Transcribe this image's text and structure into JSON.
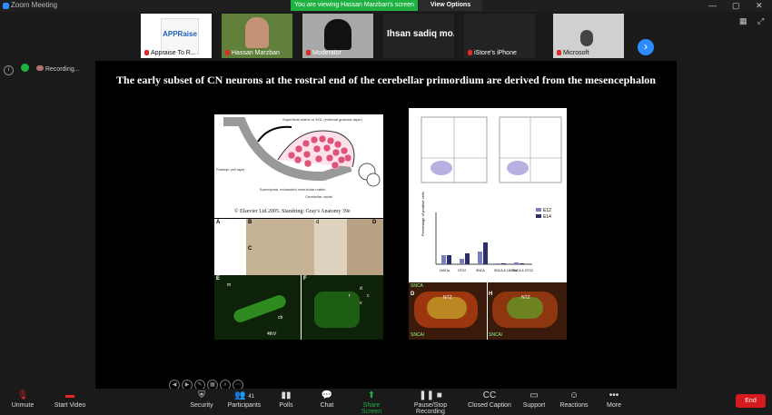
{
  "window": {
    "title": "Zoom Meeting"
  },
  "banner": {
    "text": "You are viewing Hassan Marzban's screen",
    "view_options": "View Options"
  },
  "participants": [
    {
      "name": "Appraise To R...",
      "logo_text": "APPRaise"
    },
    {
      "name": "Hassan Marzban"
    },
    {
      "name": "Moderator"
    },
    {
      "name": "Ihsan sadiq mo..."
    },
    {
      "name": "iStore's iPhone"
    },
    {
      "name": "Microsoft"
    }
  ],
  "recording": {
    "label": "Recording..."
  },
  "slide": {
    "title": "The early subset of CN neurons at the rostral end of the cerebellar primordium are derived from the mesencephalon",
    "left_panel": {
      "copyright": "© Elsevier Ltd 2005. Standring: Gray's Anatomy 39e",
      "labels": {
        "purkinje": "Purkinje cell layer",
        "nuclei": "Cerebellar nuclei",
        "ependymal": "Ependymal, exhausted ventricular matrix",
        "superficial": "Superficial matrix or EGL (external granular layer)"
      },
      "fig_letters": [
        "A",
        "B",
        "C",
        "d",
        "D",
        "E",
        "F"
      ],
      "fig_labels": [
        "m",
        "cb",
        "4thV",
        "r",
        "c",
        "d",
        "v"
      ]
    },
    "right_panel": {
      "legend": [
        "E12",
        "E14"
      ],
      "ylabel": "Percentage of positive cells",
      "categories": [
        "LMX1a",
        "OTX2",
        "SNCA",
        "SNCA & LMX1a",
        "SNCA & OTX2"
      ],
      "fig_letters": [
        "D",
        "H"
      ],
      "fig_labels": [
        "NTZ",
        "NTZ",
        "SNCA",
        "SNCA/",
        "SNCA/"
      ]
    }
  },
  "toolbar": {
    "unmute": "Unmute",
    "start_video": "Start Video",
    "security": "Security",
    "participants": "Participants",
    "participants_count": "41",
    "polls": "Polls",
    "chat": "Chat",
    "share_screen": "Share Screen",
    "pause_recording": "Pause/Stop Recording",
    "closed_caption": "Closed Caption",
    "support": "Support",
    "reactions": "Reactions",
    "more": "More",
    "end": "End"
  },
  "colors": {
    "accent": "#2d8cff",
    "share_green": "#1fb141",
    "end_red": "#d4191f"
  }
}
